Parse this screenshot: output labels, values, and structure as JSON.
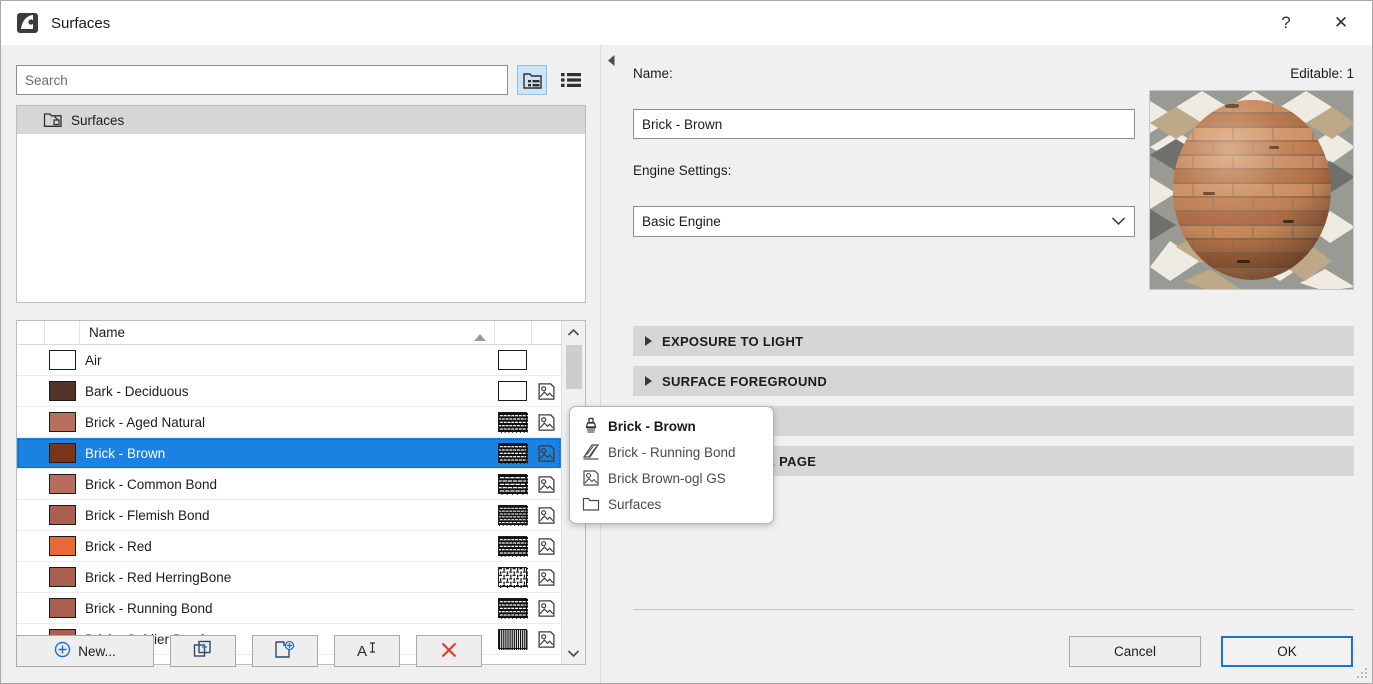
{
  "window": {
    "title": "Surfaces",
    "app_icon": "archicad-icon",
    "help_label": "?",
    "close_label": "✕"
  },
  "left_panel": {
    "search": {
      "placeholder": "Search",
      "value": ""
    },
    "view_buttons": [
      {
        "name": "tree-view-button",
        "icon": "tree-view-icon",
        "active": true
      },
      {
        "name": "list-view-button",
        "icon": "list-view-icon",
        "active": false
      }
    ],
    "tree": {
      "root_label": "Surfaces",
      "root_icon": "folder-surface-icon"
    },
    "table": {
      "columns": [
        "",
        "",
        "Name",
        "",
        ""
      ],
      "sort_column": "Name",
      "sort_direction": "ascending",
      "rows": [
        {
          "name": "Air",
          "color": "#ffffff",
          "pattern": "none",
          "texture": false
        },
        {
          "name": "Bark - Deciduous",
          "color": "#54342a",
          "pattern": "none",
          "texture": true
        },
        {
          "name": "Brick - Aged Natural",
          "color": "#b86f5c",
          "pattern": "running",
          "texture": true
        },
        {
          "name": "Brick - Brown",
          "color": "#7b3417",
          "pattern": "running",
          "texture": true,
          "selected": true
        },
        {
          "name": "Brick - Common Bond",
          "color": "#b86d5c",
          "pattern": "common",
          "texture": true
        },
        {
          "name": "Brick - Flemish Bond",
          "color": "#ab5f50",
          "pattern": "flemish",
          "texture": true
        },
        {
          "name": "Brick - Red",
          "color": "#e8683a",
          "pattern": "running",
          "texture": true
        },
        {
          "name": "Brick - Red HerringBone",
          "color": "#ab5f50",
          "pattern": "herringbone",
          "texture": true
        },
        {
          "name": "Brick - Running Bond",
          "color": "#ab5f50",
          "pattern": "running",
          "texture": true
        },
        {
          "name": "Brick - Soldier Bond",
          "color": "#ab5f50",
          "pattern": "soldier",
          "texture": true
        }
      ],
      "scroll": {
        "up_icon": "chevron-up-icon",
        "down_icon": "chevron-down-icon"
      }
    },
    "buttons": [
      {
        "name": "new-button",
        "label": "New...",
        "icon": "plus-circle-icon"
      },
      {
        "name": "duplicate-button",
        "label": "",
        "icon": "duplicate-icon"
      },
      {
        "name": "new-from-favorite-button",
        "label": "",
        "icon": "page-plus-icon"
      },
      {
        "name": "rename-button",
        "label": "",
        "icon": "rename-text-icon"
      },
      {
        "name": "delete-button",
        "label": "",
        "icon": "red-x-icon"
      }
    ]
  },
  "right_panel": {
    "collapse_handle_icon": "triangle-left-icon",
    "name_label": "Name:",
    "editable_label": "Editable: 1",
    "name_value": "Brick - Brown",
    "engine_label": "Engine Settings:",
    "engine_value": "Basic Engine",
    "engine_caret_icon": "chevron-down-icon",
    "preview_alt": "brick-sphere-preview",
    "sections": [
      {
        "name": "section-exposure-to-light",
        "label": "EXPOSURE TO LIGHT",
        "expanded": false
      },
      {
        "name": "section-surface-foreground",
        "label": "SURFACE FOREGROUND",
        "expanded": false
      },
      {
        "name": "section-third",
        "label": "",
        "expanded": false
      },
      {
        "name": "section-test-attribute-page",
        "label": "TEST ATTRIBUTE PAGE",
        "expanded": false
      }
    ],
    "buttons": [
      {
        "name": "cancel-button",
        "label": "Cancel",
        "primary": false
      },
      {
        "name": "ok-button",
        "label": "OK",
        "primary": true
      }
    ]
  },
  "popup": {
    "items": [
      {
        "label": "Brick - Brown",
        "icon": "brush-icon",
        "bold": true
      },
      {
        "label": "Brick - Running Bond",
        "icon": "hatch-icon",
        "bold": false
      },
      {
        "label": "Brick Brown-ogl GS",
        "icon": "image-icon",
        "bold": false
      },
      {
        "label": "Surfaces",
        "icon": "folder-icon",
        "bold": false
      }
    ]
  },
  "colors": {
    "accent": "#1c82e2",
    "primary_border": "#1a73d4",
    "header_gray": "#d6d6d6",
    "delete_red": "#e8392c"
  }
}
